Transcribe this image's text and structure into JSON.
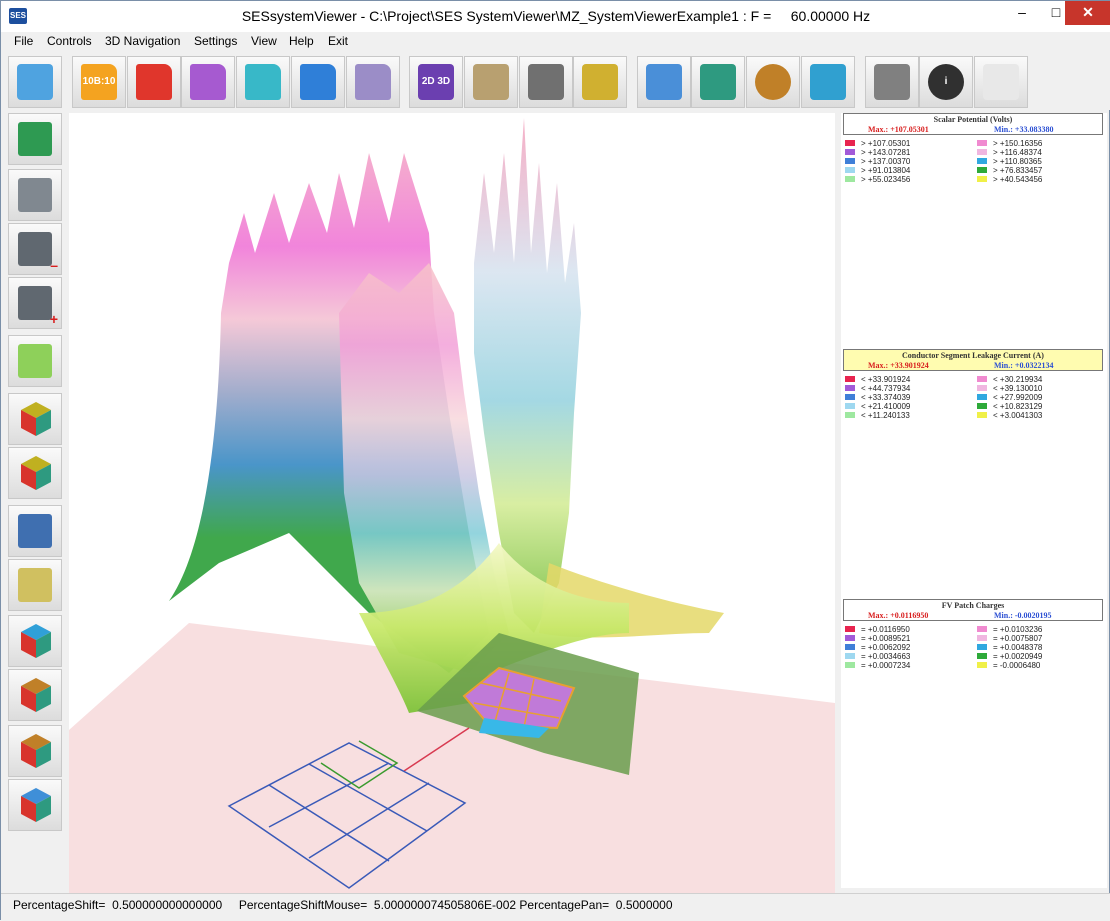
{
  "window": {
    "title": "SESsystemViewer - C:\\Project\\SES SystemViewer\\MZ_SystemViewerExample1 : F =     60.00000 Hz",
    "app_icon_text": "SES",
    "minimize_glyph": "–",
    "maximize_glyph": "□",
    "close_glyph": "✕"
  },
  "menu": [
    "File",
    "Controls",
    "3D Navigation",
    "Settings",
    "View",
    "Help",
    "Exit"
  ],
  "toolbar": {
    "buttons": [
      {
        "name": "speech-bubble-icon",
        "color": "#4fa3e0"
      },
      {
        "name": "folder-data-orange-icon",
        "color": "#f4a320",
        "label": "10B:10"
      },
      {
        "name": "folder-red-icon",
        "color": "#e0362c"
      },
      {
        "name": "folder-purple-icon",
        "color": "#a65ad0"
      },
      {
        "name": "folder-cyan-icon",
        "color": "#38b8c8"
      },
      {
        "name": "folder-blue-icon",
        "color": "#2f7fd8"
      },
      {
        "name": "folder-grid-icon",
        "color": "#9b8dc7"
      },
      {
        "name": "view-2d-3d-icon",
        "color": "#6b3fb0",
        "label": "2D 3D"
      },
      {
        "name": "gears-settings-icon",
        "color": "#b8a070"
      },
      {
        "name": "keyboard-mouse-icon",
        "color": "#707070"
      },
      {
        "name": "joystick-icon",
        "color": "#d0b030"
      },
      {
        "name": "zoom-magnifier-icon",
        "color": "#4a8fd8"
      },
      {
        "name": "fit-window-arrows-icon",
        "color": "#2e9a80"
      },
      {
        "name": "planet-orbit-icon",
        "color": "#c08028"
      },
      {
        "name": "stacked-cubes-icon",
        "color": "#30a0d0"
      },
      {
        "name": "printer-icon",
        "color": "#808080"
      },
      {
        "name": "info-icon",
        "color": "#303030",
        "label": "i"
      },
      {
        "name": "blank-tool-icon",
        "color": "#e8e8e8"
      }
    ]
  },
  "sidebar": {
    "buttons": [
      {
        "name": "shield-view-icon",
        "color": "#2e9a52"
      },
      {
        "name": "video-camera-icon",
        "color": "#808890"
      },
      {
        "name": "camera-zoom-out-icon",
        "color": "#606870",
        "badge": "–"
      },
      {
        "name": "camera-zoom-in-icon",
        "color": "#606870",
        "badge": "+"
      },
      {
        "name": "flashlight-icon",
        "color": "#8ed05a"
      },
      {
        "name": "color-cube-icon",
        "color": "#c0b020"
      },
      {
        "name": "color-cube-solid-icon",
        "color": "#c0b020"
      },
      {
        "name": "layers-blue-icon",
        "color": "#3f6fb0"
      },
      {
        "name": "layers-outline-icon",
        "color": "#d0c060"
      },
      {
        "name": "blocks-cubes-icon",
        "color": "#30a0d8"
      },
      {
        "name": "wire-cube-icon",
        "color": "#c08028"
      },
      {
        "name": "lattice-cube-icon",
        "color": "#c08028"
      },
      {
        "name": "rotate-cube-icon",
        "color": "#3f8fd8"
      }
    ]
  },
  "legends": [
    {
      "title": "Scalar Potential (Volts)",
      "max_text": "Max.: +107.05301",
      "min_text": "Min.: +33.083380",
      "style": "white",
      "entries": [
        {
          "color": "#e8244f",
          "text": "> +107.05301"
        },
        {
          "color": "#f08ad0",
          "text": "> +150.16356"
        },
        {
          "color": "#a25ad8",
          "text": "> +143.07281"
        },
        {
          "color": "#f0b6e0",
          "text": "> +116.48374"
        },
        {
          "color": "#3f7fd8",
          "text": "> +137.00370"
        },
        {
          "color": "#30a8e0",
          "text": "> +110.80365"
        },
        {
          "color": "#9ed8f0",
          "text": "> +91.013804"
        },
        {
          "color": "#2eaa3a",
          "text": "> +76.833457"
        },
        {
          "color": "#9ee8a0",
          "text": "> +55.023456"
        },
        {
          "color": "#f0f048",
          "text": "> +40.543456"
        }
      ]
    },
    {
      "title": "Conductor Segment Leakage Current (A)",
      "max_text": "Max.: +33.901924",
      "min_text": "Min.: +0.0322134",
      "style": "yellow",
      "entries": [
        {
          "color": "#e8244f",
          "text": "< +33.901924"
        },
        {
          "color": "#f08ad0",
          "text": "< +30.219934"
        },
        {
          "color": "#a25ad8",
          "text": "< +44.737934"
        },
        {
          "color": "#f0b6e0",
          "text": "< +39.130010"
        },
        {
          "color": "#3f7fd8",
          "text": "< +33.374039"
        },
        {
          "color": "#30a8e0",
          "text": "< +27.992009"
        },
        {
          "color": "#9ed8f0",
          "text": "< +21.410009"
        },
        {
          "color": "#2eaa3a",
          "text": "< +10.823129"
        },
        {
          "color": "#9ee8a0",
          "text": "< +11.240133"
        },
        {
          "color": "#f0f048",
          "text": "< +3.0041303"
        }
      ]
    },
    {
      "title": "FV Patch Charges",
      "max_text": "Max.: +0.0116950",
      "min_text": "Min.: -0.0020195",
      "style": "white",
      "entries": [
        {
          "color": "#e8244f",
          "text": "= +0.0116950"
        },
        {
          "color": "#f08ad0",
          "text": "= +0.0103236"
        },
        {
          "color": "#a25ad8",
          "text": "= +0.0089521"
        },
        {
          "color": "#f0b6e0",
          "text": "= +0.0075807"
        },
        {
          "color": "#3f7fd8",
          "text": "= +0.0062092"
        },
        {
          "color": "#30a8e0",
          "text": "= +0.0048378"
        },
        {
          "color": "#9ed8f0",
          "text": "= +0.0034663"
        },
        {
          "color": "#2eaa3a",
          "text": "= +0.0020949"
        },
        {
          "color": "#9ee8a0",
          "text": "= +0.0007234"
        },
        {
          "color": "#f0f048",
          "text": "= -0.0006480"
        }
      ]
    }
  ],
  "status": {
    "text": "PercentageShift=  0.500000000000000     PercentageShiftMouse=  5.000000074505806E-002 PercentagePan=  0.5000000"
  }
}
